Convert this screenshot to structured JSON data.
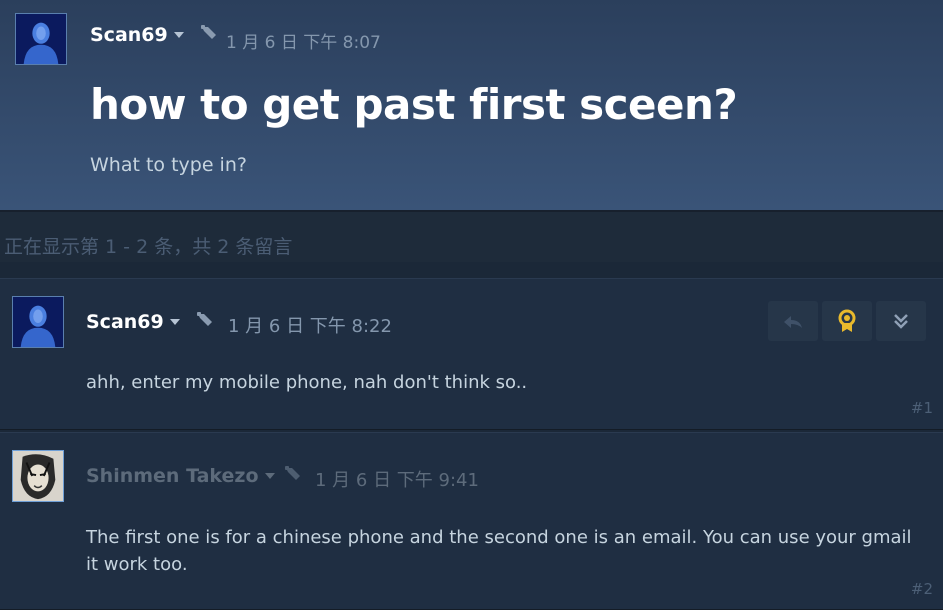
{
  "original_post": {
    "author": "Scan69",
    "timestamp": "1 月 6 日 下午 8:07",
    "title": "how to get past first sceen?",
    "body": "What to type in?"
  },
  "comment_count": "正在显示第 1 - 2 条，共 2 条留言",
  "replies": [
    {
      "author": "Scan69",
      "timestamp": "1 月 6 日 下午 8:22",
      "body": "ahh, enter my mobile phone, nah don't think so..",
      "number": "#1"
    },
    {
      "author": "Shinmen Takezo",
      "timestamp": "1 月 6 日 下午 9:41",
      "body_line1": "The first one is for a chinese phone and the second one is an email. You can use your gmail",
      "body_line2": "it work too.",
      "number": "#2"
    }
  ],
  "colors": {
    "background": "#1b2838",
    "award": "#e8b92c"
  }
}
